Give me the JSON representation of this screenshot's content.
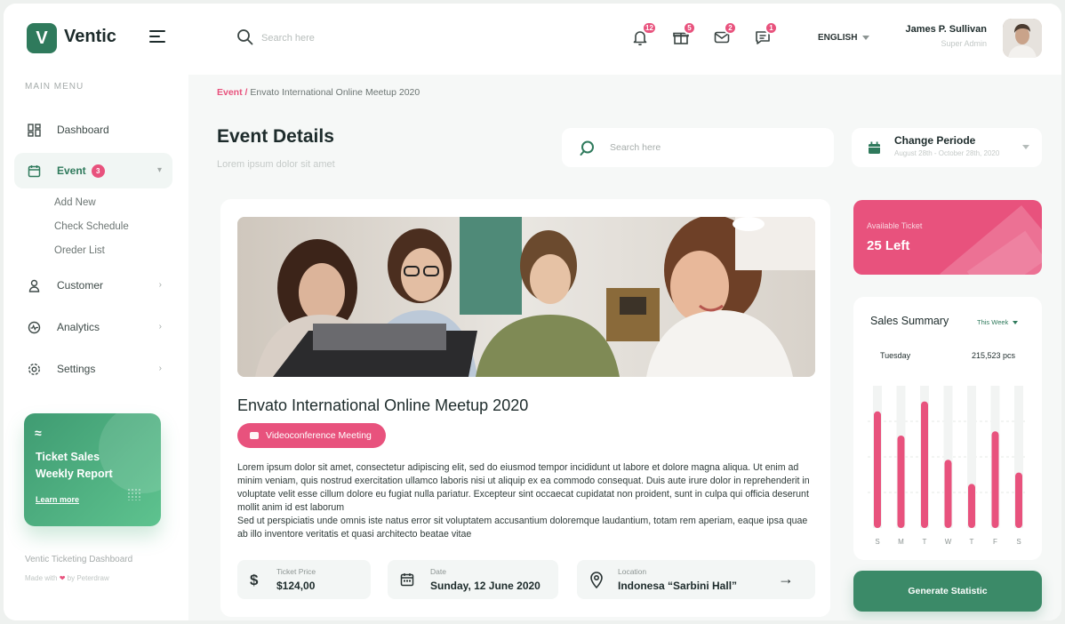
{
  "brand": {
    "name": "Ventic",
    "logo_letter": "V",
    "color": "#2f7a5c"
  },
  "topbar": {
    "search_placeholder": "Search here",
    "notifications": [
      {
        "icon": "bell-icon",
        "count": "12"
      },
      {
        "icon": "gift-icon",
        "count": "5"
      },
      {
        "icon": "mail-icon",
        "count": "2"
      },
      {
        "icon": "chat-icon",
        "count": "1"
      }
    ],
    "language": "ENGLISH",
    "user": {
      "name": "James P. Sullivan",
      "role": "Super Admin"
    }
  },
  "sidebar": {
    "menu_title": "MAIN MENU",
    "items": [
      {
        "label": "Dashboard",
        "icon": "dashboard-icon"
      },
      {
        "label": "Event",
        "icon": "calendar-icon",
        "badge": "3",
        "active": true
      },
      {
        "label": "Customer",
        "icon": "user-icon"
      },
      {
        "label": "Analytics",
        "icon": "analytics-icon"
      },
      {
        "label": "Settings",
        "icon": "gear-icon"
      }
    ],
    "event_subitems": [
      "Add New",
      "Check Schedule",
      "Oreder List"
    ],
    "promo": {
      "title_line1": "Ticket Sales",
      "title_line2": "Weekly Report",
      "link": "Learn more"
    },
    "footer": {
      "title": "Ventic Ticketing Dashboard",
      "made_prefix": "Made with",
      "made_suffix": "by Peterdraw"
    }
  },
  "main": {
    "breadcrumb": {
      "active": "Event /",
      "current": "Envato International Online Meetup 2020"
    },
    "title": "Event Details",
    "subtitle": "Lorem ipsum  dolor sit amet",
    "search_placeholder": "Search here",
    "periode": {
      "title": "Change Periode",
      "range": "August 28th - October 28th, 2020"
    }
  },
  "event": {
    "title": "Envato International Online Meetup 2020",
    "tag": "Videoconference Meeting",
    "description_p1": "Lorem ipsum dolor sit amet, consectetur adipiscing elit, sed do eiusmod tempor incididunt ut labore et dolore magna aliqua. Ut enim ad minim veniam, quis nostrud exercitation ullamco laboris nisi ut aliquip ex ea commodo consequat. Duis aute irure dolor in reprehenderit in voluptate velit esse cillum dolore eu fugiat nulla pariatur. Excepteur sint occaecat cupidatat non proident, sunt in culpa qui officia deserunt mollit anim id est laborum",
    "description_p2": "Sed ut perspiciatis unde omnis iste natus error sit voluptatem accusantium doloremque laudantium, totam rem aperiam, eaque ipsa quae ab illo inventore veritatis et quasi architecto beatae vitae",
    "price": {
      "label": "Ticket Price",
      "value": "$124,00",
      "icon": "dollar-icon"
    },
    "date": {
      "label": "Date",
      "value": "Sunday, 12 June 2020",
      "icon": "calendar-icon"
    },
    "location": {
      "label": "Location",
      "value": "Indonesa “Sarbini Hall”",
      "icon": "location-pin-icon"
    }
  },
  "ticket": {
    "label": "Available Ticket",
    "value": "25 Left",
    "color": "#e8527d"
  },
  "sales_summary": {
    "title": "Sales Summary",
    "filter": "This Week",
    "selected_day": "Tuesday",
    "selected_value": "215,523 pcs"
  },
  "generate_button": "Generate Statistic",
  "chart_data": {
    "type": "bar",
    "categories": [
      "S",
      "M",
      "T",
      "W",
      "T",
      "F",
      "S"
    ],
    "values": [
      82,
      65,
      89,
      48,
      31,
      68,
      39
    ],
    "ylim": [
      0,
      100
    ],
    "grid": true,
    "bar_color": "#e8527d"
  }
}
